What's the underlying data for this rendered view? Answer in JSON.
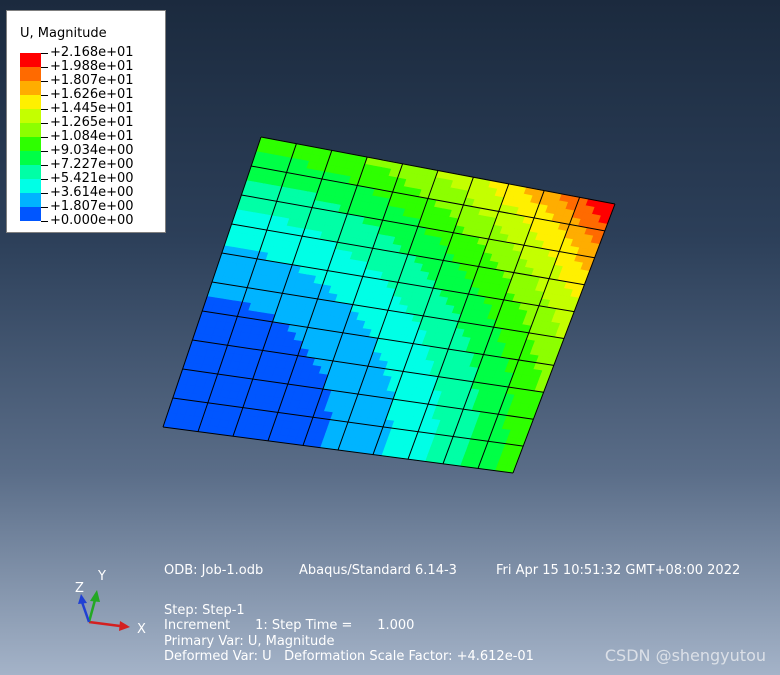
{
  "legend": {
    "title": "U, Magnitude",
    "entries": [
      {
        "label": "+2.168e+01",
        "color": "#ff0000"
      },
      {
        "label": "+1.988e+01",
        "color": "#ff6a00"
      },
      {
        "label": "+1.807e+01",
        "color": "#ffad00"
      },
      {
        "label": "+1.626e+01",
        "color": "#fff000"
      },
      {
        "label": "+1.445e+01",
        "color": "#c4ff00"
      },
      {
        "label": "+1.265e+01",
        "color": "#8cff00"
      },
      {
        "label": "+1.084e+01",
        "color": "#2eff00"
      },
      {
        "label": "+9.034e+00",
        "color": "#00ff46"
      },
      {
        "label": "+7.227e+00",
        "color": "#00ffa6"
      },
      {
        "label": "+5.421e+00",
        "color": "#00ffe6"
      },
      {
        "label": "+3.614e+00",
        "color": "#00b4ff"
      },
      {
        "label": "+1.807e+00",
        "color": "#0056ff"
      },
      {
        "label": "+0.000e+00",
        "color": "#0000ff"
      }
    ]
  },
  "contour": {
    "max_value": 21.68,
    "mesh_rows": 10,
    "mesh_cols": 10
  },
  "info": {
    "odb": "ODB: Job-1.odb",
    "solver": "Abaqus/Standard 6.14-3",
    "timestamp": "Fri Apr 15 10:51:32 GMT+08:00 2022",
    "step": "Step: Step-1",
    "increment": "Increment      1: Step Time =      1.000",
    "primary_var": "Primary Var: U, Magnitude",
    "deformed_var": "Deformed Var: U   Deformation Scale Factor: +4.612e-01"
  },
  "triad": {
    "x_label": "X",
    "y_label": "Y",
    "z_label": "Z",
    "x_color": "#d42020",
    "y_color": "#23a823",
    "z_color": "#2040d4"
  },
  "watermark": "CSDN @shengyutou"
}
